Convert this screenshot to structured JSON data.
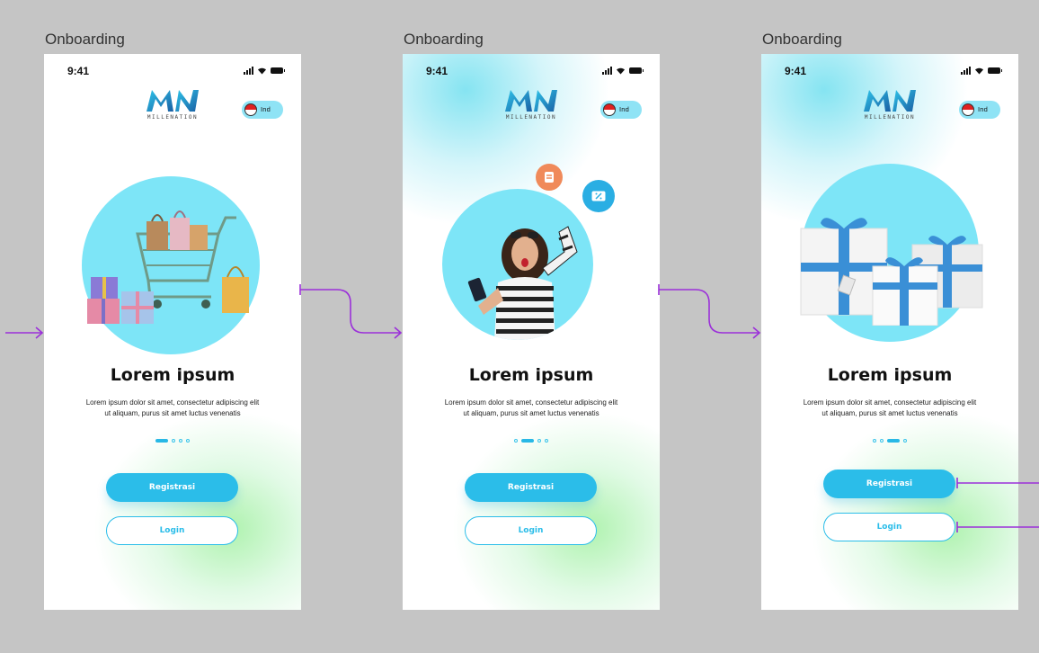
{
  "frames": [
    {
      "label": "Onboarding",
      "status": {
        "time": "9:41"
      },
      "logo": {
        "mark": "MN",
        "subtitle": "MILLENATION"
      },
      "language": {
        "code": "Ind"
      },
      "title": "Lorem ipsum",
      "description_line1": "Lorem ipsum dolor sit amet, consectetur adipiscing elit",
      "description_line2": "ut aliquam, purus sit amet luctus venenatis",
      "page_indicator": {
        "active": 1,
        "total": 4
      },
      "register_label": "Registrasi",
      "login_label": "Login",
      "illustration": "shopping-cart-illustration"
    },
    {
      "label": "Onboarding",
      "status": {
        "time": "9:41"
      },
      "logo": {
        "mark": "MN",
        "subtitle": "MILLENATION"
      },
      "language": {
        "code": "Ind"
      },
      "title": "Lorem ipsum",
      "description_line1": "Lorem ipsum dolor sit amet, consectetur adipiscing elit",
      "description_line2": "ut aliquam, purus sit amet luctus venenatis",
      "page_indicator": {
        "active": 2,
        "total": 4
      },
      "register_label": "Registrasi",
      "login_label": "Login",
      "illustration": "woman-with-phone-illustration"
    },
    {
      "label": "Onboarding",
      "status": {
        "time": "9:41"
      },
      "logo": {
        "mark": "MN",
        "subtitle": "MILLENATION"
      },
      "language": {
        "code": "Ind"
      },
      "title": "Lorem ipsum",
      "description_line1": "Lorem ipsum dolor sit amet, consectetur adipiscing elit",
      "description_line2": "ut aliquam, purus sit amet luctus venenatis",
      "page_indicator": {
        "active": 3,
        "total": 4
      },
      "register_label": "Registrasi",
      "login_label": "Login",
      "illustration": "gift-boxes-illustration"
    }
  ],
  "colors": {
    "canvas": "#c5c5c5",
    "accent": "#2bbde9",
    "hero_circle": "#7de5f7",
    "prototype_connector": "#9b30d9"
  }
}
